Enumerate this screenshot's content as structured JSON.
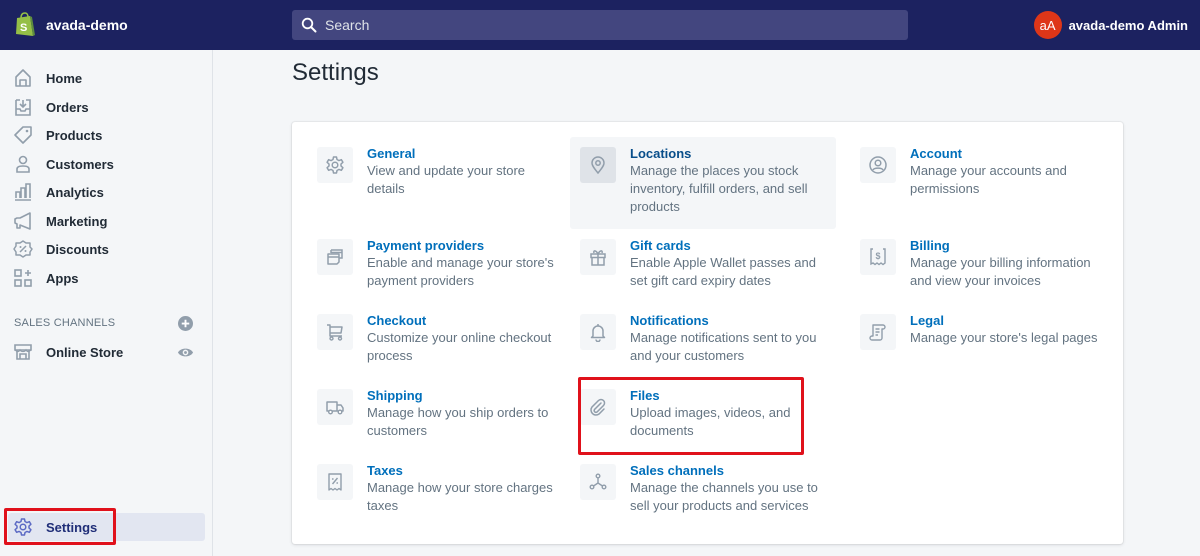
{
  "topbar": {
    "store_name": "avada-demo",
    "search_placeholder": "Search",
    "user": {
      "initials": "aA",
      "name": "avada-demo Admin"
    }
  },
  "sidebar": {
    "items": [
      {
        "label": "Home",
        "icon": "home-icon"
      },
      {
        "label": "Orders",
        "icon": "orders-icon"
      },
      {
        "label": "Products",
        "icon": "tag-icon"
      },
      {
        "label": "Customers",
        "icon": "person-icon"
      },
      {
        "label": "Analytics",
        "icon": "bar-chart-icon"
      },
      {
        "label": "Marketing",
        "icon": "megaphone-icon"
      },
      {
        "label": "Discounts",
        "icon": "discount-icon"
      },
      {
        "label": "Apps",
        "icon": "apps-icon"
      }
    ],
    "sales_channels_title": "SALES CHANNELS",
    "channels": [
      {
        "label": "Online Store",
        "icon": "store-icon"
      }
    ],
    "settings_label": "Settings",
    "active_item": "Settings"
  },
  "main": {
    "title": "Settings",
    "settings": [
      {
        "title": "General",
        "description": "View and update your store details",
        "icon": "gear-icon"
      },
      {
        "title": "Locations",
        "description": "Manage the places you stock inventory, fulfill orders, and sell products",
        "icon": "location-pin-icon",
        "hovered": true
      },
      {
        "title": "Account",
        "description": "Manage your accounts and permissions",
        "icon": "account-icon"
      },
      {
        "title": "Payment providers",
        "description": "Enable and manage your store's payment providers",
        "icon": "payment-icon"
      },
      {
        "title": "Gift cards",
        "description": "Enable Apple Wallet passes and set gift card expiry dates",
        "icon": "gift-icon"
      },
      {
        "title": "Billing",
        "description": "Manage your billing information and view your invoices",
        "icon": "billing-icon"
      },
      {
        "title": "Checkout",
        "description": "Customize your online checkout process",
        "icon": "cart-icon"
      },
      {
        "title": "Notifications",
        "description": "Manage notifications sent to you and your customers",
        "icon": "bell-icon"
      },
      {
        "title": "Legal",
        "description": "Manage your store's legal pages",
        "icon": "legal-icon"
      },
      {
        "title": "Shipping",
        "description": "Manage how you ship orders to customers",
        "icon": "truck-icon"
      },
      {
        "title": "Files",
        "description": "Upload images, videos, and documents",
        "icon": "paperclip-icon",
        "highlighted": true
      },
      {
        "title": "Taxes",
        "description": "Manage how your store charges taxes",
        "icon": "tax-receipt-icon"
      },
      {
        "title": "Sales channels",
        "description": "Manage the channels you use to sell your products and services",
        "icon": "channels-icon"
      }
    ]
  },
  "colors": {
    "topbar": "#1c2260",
    "search_bg": "#43467f",
    "link": "#006fbb",
    "avatar": "#de3618",
    "highlight": "#e0111b",
    "active_nav": "#e2e6f1"
  }
}
